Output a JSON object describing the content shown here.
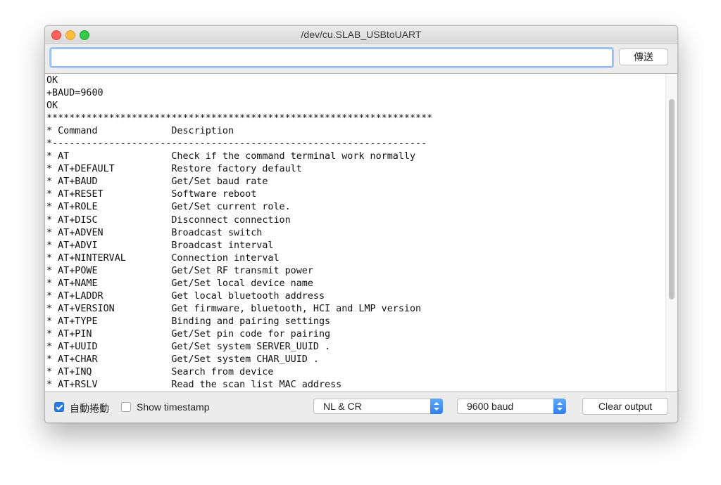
{
  "window": {
    "title": "/dev/cu.SLAB_USBtoUART"
  },
  "send": {
    "input_value": "",
    "button_label": "傳送"
  },
  "output": {
    "lines": [
      "OK",
      "+BAUD=9600",
      "OK",
      "********************************************************************",
      "* Command             Description",
      "*------------------------------------------------------------------",
      "* AT                  Check if the command terminal work normally",
      "* AT+DEFAULT          Restore factory default",
      "* AT+BAUD             Get/Set baud rate",
      "* AT+RESET            Software reboot",
      "* AT+ROLE             Get/Set current role.",
      "* AT+DISC             Disconnect connection",
      "* AT+ADVEN            Broadcast switch",
      "* AT+ADVI             Broadcast interval",
      "* AT+NINTERVAL        Connection interval",
      "* AT+POWE             Get/Set RF transmit power",
      "* AT+NAME             Get/Set local device name",
      "* AT+LADDR            Get local bluetooth address",
      "* AT+VERSION          Get firmware, bluetooth, HCI and LMP version",
      "* AT+TYPE             Binding and pairing settings",
      "* AT+PIN              Get/Set pin code for pairing",
      "* AT+UUID             Get/Set system SERVER_UUID .",
      "* AT+CHAR             Get/Set system CHAR_UUID .",
      "* AT+INQ              Search from device",
      "* AT+RSLV             Read the scan list MAC address"
    ]
  },
  "bottom_bar": {
    "autoscroll": {
      "label": "自動捲動",
      "checked": true
    },
    "show_timestamp": {
      "label": "Show timestamp",
      "checked": false
    },
    "line_ending": {
      "selected": "NL & CR"
    },
    "baud_rate": {
      "selected": "9600 baud"
    },
    "clear_button_label": "Clear output"
  },
  "colors": {
    "accent": "#2b7de1",
    "close": "#fc605b",
    "minimize": "#fdbc40",
    "maximize": "#34c84a"
  }
}
